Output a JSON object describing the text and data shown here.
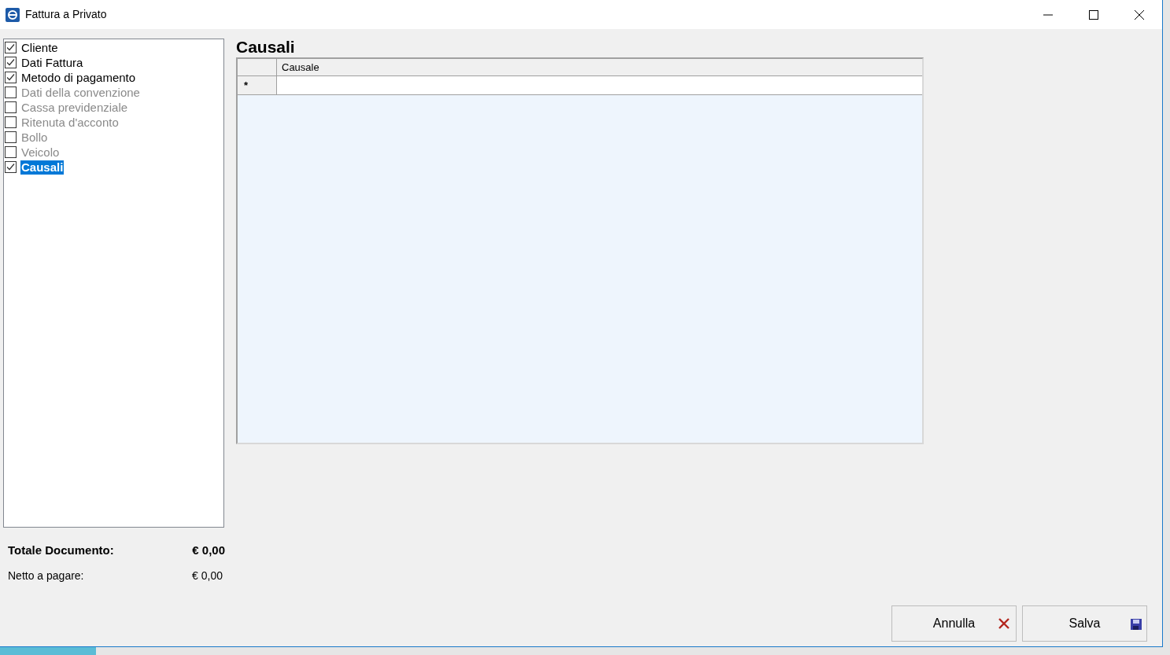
{
  "window": {
    "title": "Fattura a Privato"
  },
  "sections": [
    {
      "label": "Cliente",
      "checked": true,
      "disabled": false,
      "selected": false
    },
    {
      "label": "Dati Fattura",
      "checked": true,
      "disabled": false,
      "selected": false
    },
    {
      "label": "Metodo di pagamento",
      "checked": true,
      "disabled": false,
      "selected": false
    },
    {
      "label": "Dati della convenzione",
      "checked": false,
      "disabled": true,
      "selected": false
    },
    {
      "label": "Cassa previdenziale",
      "checked": false,
      "disabled": true,
      "selected": false
    },
    {
      "label": "Ritenuta d'acconto",
      "checked": false,
      "disabled": true,
      "selected": false
    },
    {
      "label": "Bollo",
      "checked": false,
      "disabled": true,
      "selected": false
    },
    {
      "label": "Veicolo",
      "checked": false,
      "disabled": true,
      "selected": false
    },
    {
      "label": "Causali",
      "checked": true,
      "disabled": false,
      "selected": true
    }
  ],
  "panel": {
    "title": "Causali",
    "table": {
      "columns": [
        "Causale"
      ],
      "new_row_marker": "*"
    }
  },
  "totals": [
    {
      "label": "Totale Documento:",
      "value": "€ 0,00",
      "bold": true
    },
    {
      "label": "Netto a pagare:",
      "value": "€ 0,00",
      "bold": false
    }
  ],
  "buttons": [
    {
      "label": "Annulla",
      "kind": "cancel"
    },
    {
      "label": "Salva",
      "kind": "save"
    }
  ]
}
